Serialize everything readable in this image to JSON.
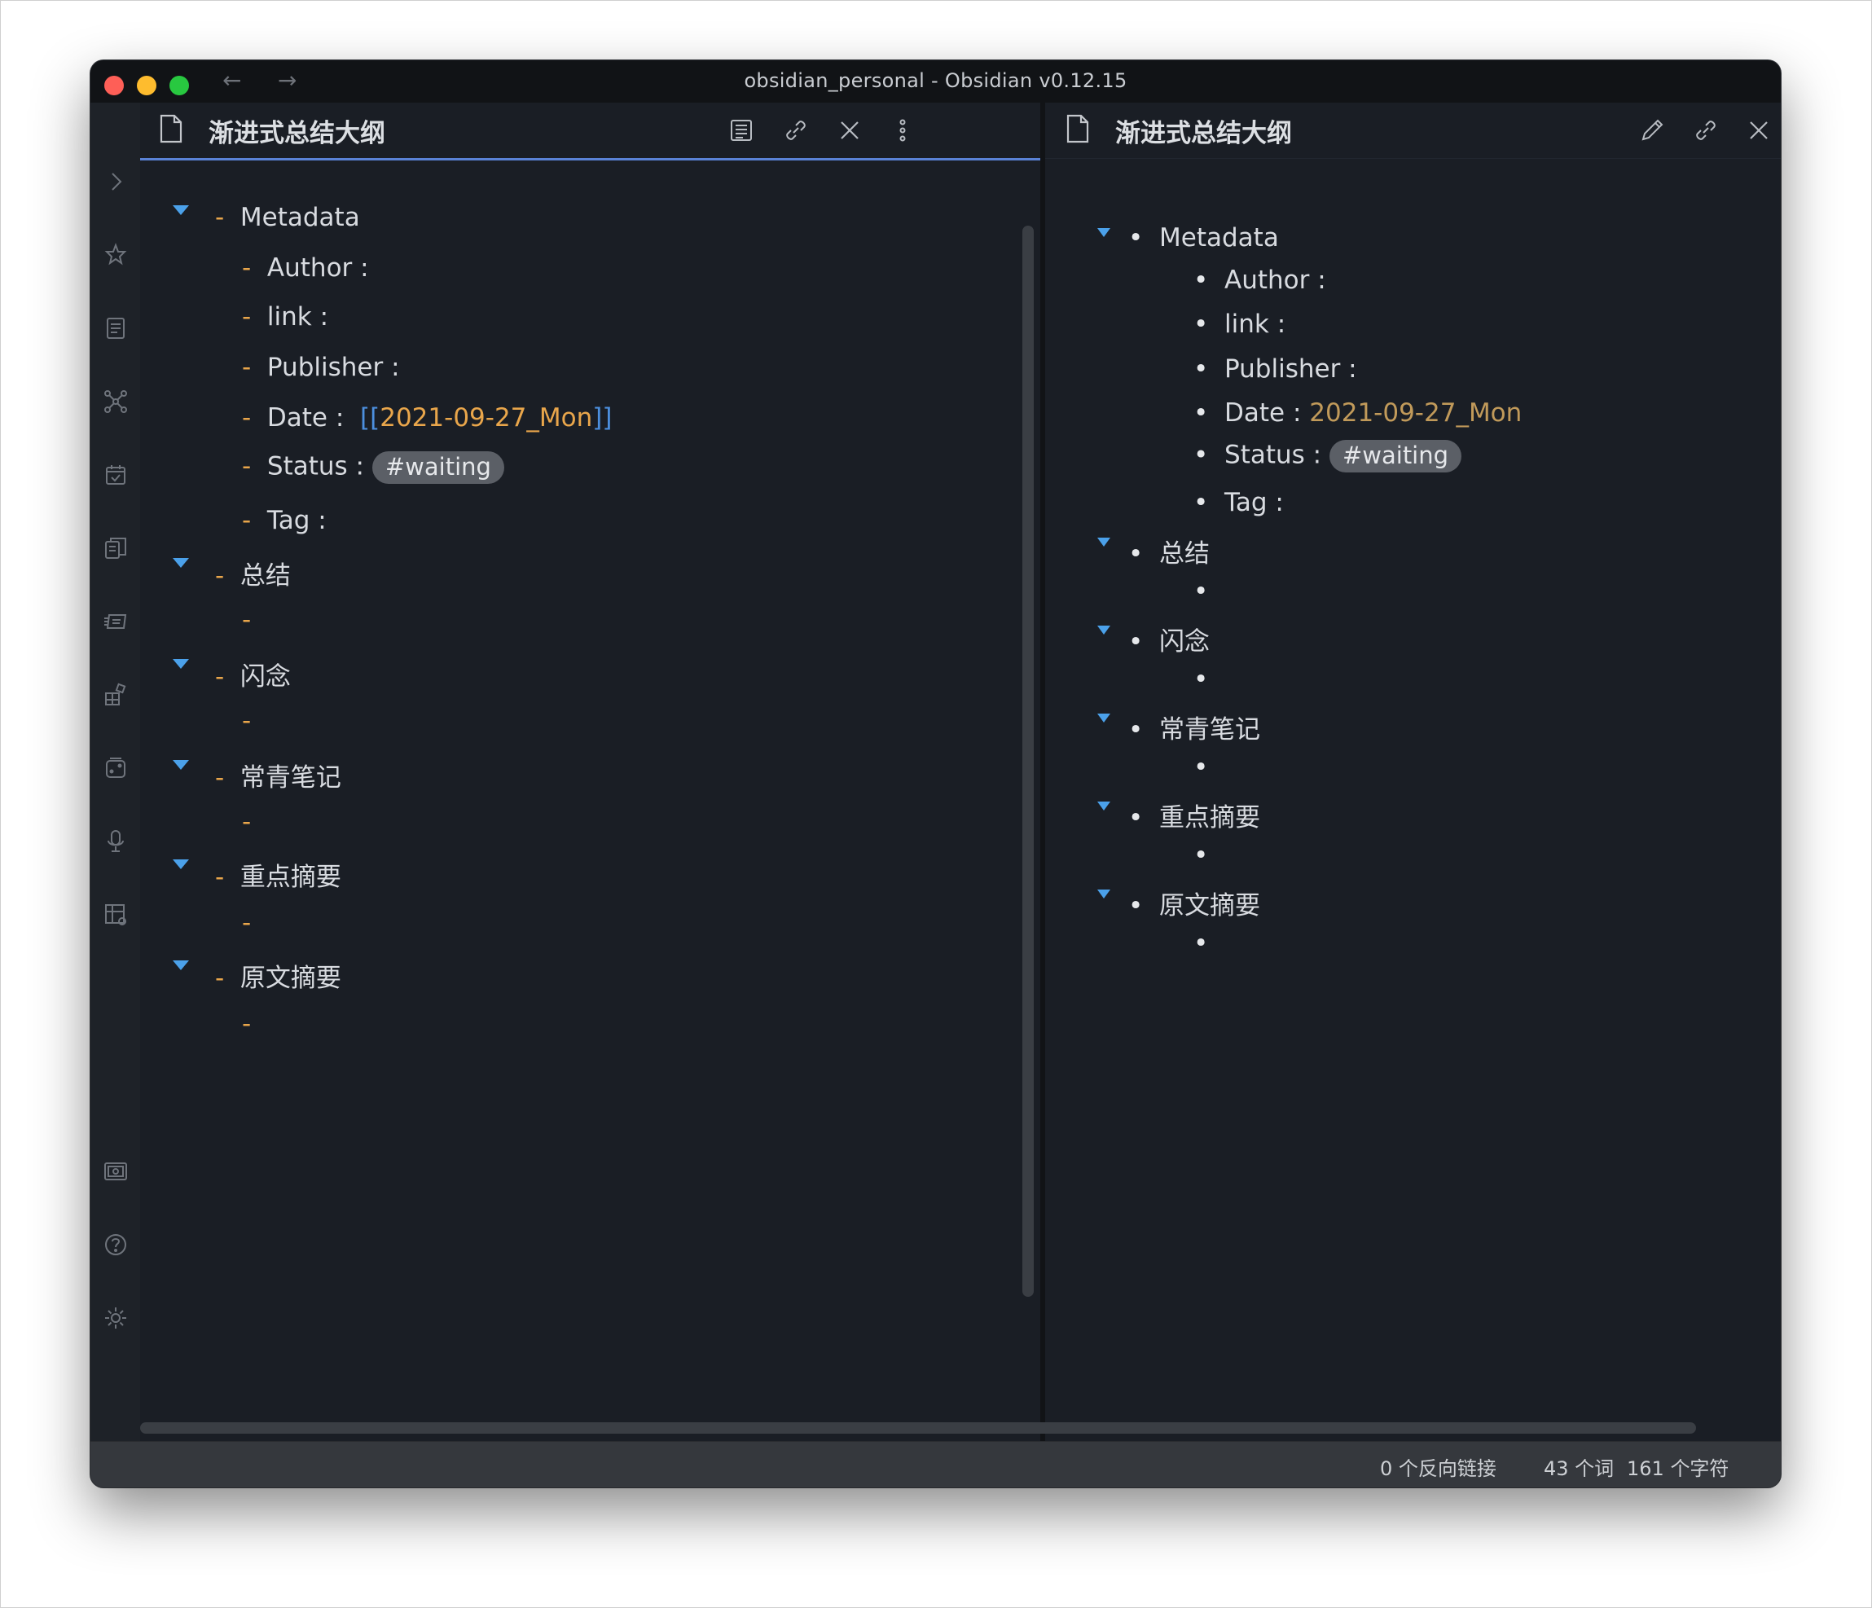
{
  "window": {
    "title": "obsidian_personal - Obsidian v0.12.15",
    "nav_back": "←",
    "nav_forward": "→"
  },
  "ribbon": {
    "expand_icon": "chevron-right-icon",
    "icons": [
      "graph-star-icon",
      "file-explorer-icon",
      "graph-view-icon",
      "calendar-check-icon",
      "templates-icon",
      "slides-icon",
      "plugin-blocks-icon",
      "dice-icon",
      "microphone-icon",
      "dashboard-icon"
    ],
    "bottom_icons": [
      "vault-icon",
      "help-icon",
      "settings-icon"
    ]
  },
  "left_pane": {
    "title": "渐进式总结大纲",
    "mode": "source",
    "header_icons": [
      "preview-mode-icon",
      "link-icon",
      "close-icon",
      "more-options-icon"
    ],
    "outline": {
      "metadata": "Metadata",
      "author": "Author :",
      "link": "link :",
      "publisher": "Publisher :",
      "date_label": "Date :",
      "date_open": "[[",
      "date_value": "2021-09-27_Mon",
      "date_close": "]]",
      "status_label": "Status :",
      "status_tag": "#waiting",
      "tag": "Tag :",
      "sections": [
        "总结",
        "闪念",
        "常青笔记",
        "重点摘要",
        "原文摘要"
      ],
      "marker": "-"
    }
  },
  "right_pane": {
    "title": "渐进式总结大纲",
    "mode": "preview",
    "header_icons": [
      "edit-icon",
      "link-icon",
      "close-icon",
      "more-options-icon"
    ],
    "outline": {
      "metadata": "Metadata",
      "author": "Author :",
      "link": "link :",
      "publisher": "Publisher :",
      "date_label": "Date :",
      "date_value": "2021-09-27_Mon",
      "status_label": "Status :",
      "status_tag": "#waiting",
      "tag": "Tag :",
      "sections": [
        "总结",
        "闪念",
        "常青笔记",
        "重点摘要",
        "原文摘要"
      ],
      "marker": "•"
    }
  },
  "right_ribbon": {
    "collapse_icon": "chevron-left-icon"
  },
  "statusbar": {
    "backlinks": "0 个反向链接",
    "words": "43 个词",
    "chars": "161 个字符"
  },
  "colors": {
    "accent": "#5a82d6",
    "list_marker": "#e9a64b",
    "fold_triangle": "#4ba1ea",
    "tag_bg": "#5b5f66",
    "background": "#1a1e25"
  }
}
